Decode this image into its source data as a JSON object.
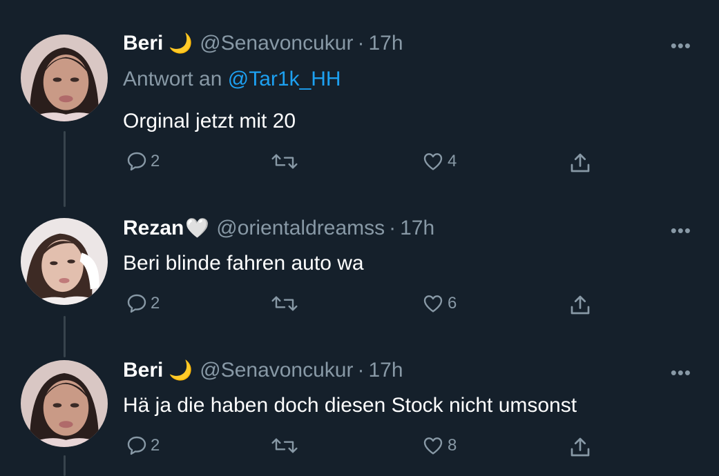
{
  "tweets": [
    {
      "name": "Beri",
      "emoji": "🌙",
      "handle": "@Senavoncukur",
      "dot": "·",
      "time": "17h",
      "reply_prefix": "Antwort an",
      "reply_to": "@Tar1k_HH",
      "text": "Orginal jetzt mit 20",
      "replies": "2",
      "likes": "4"
    },
    {
      "name": "Rezan",
      "emoji": "🤍",
      "handle": "@orientaldreamss",
      "dot": "·",
      "time": "17h",
      "text": "Beri blinde fahren auto wa",
      "replies": "2",
      "likes": "6"
    },
    {
      "name": "Beri",
      "emoji": "🌙",
      "handle": "@Senavoncukur",
      "dot": "·",
      "time": "17h",
      "text": "Hä ja die haben doch diesen Stock nicht umsonst",
      "replies": "2",
      "likes": "8"
    }
  ],
  "more_label": "•••",
  "colors": {
    "background": "#15202b",
    "secondary_text": "#8899a6",
    "link": "#1da1f2",
    "thread_line": "#38444d"
  },
  "icons": [
    "reply-icon",
    "retweet-icon",
    "like-icon",
    "share-icon",
    "more-icon"
  ]
}
